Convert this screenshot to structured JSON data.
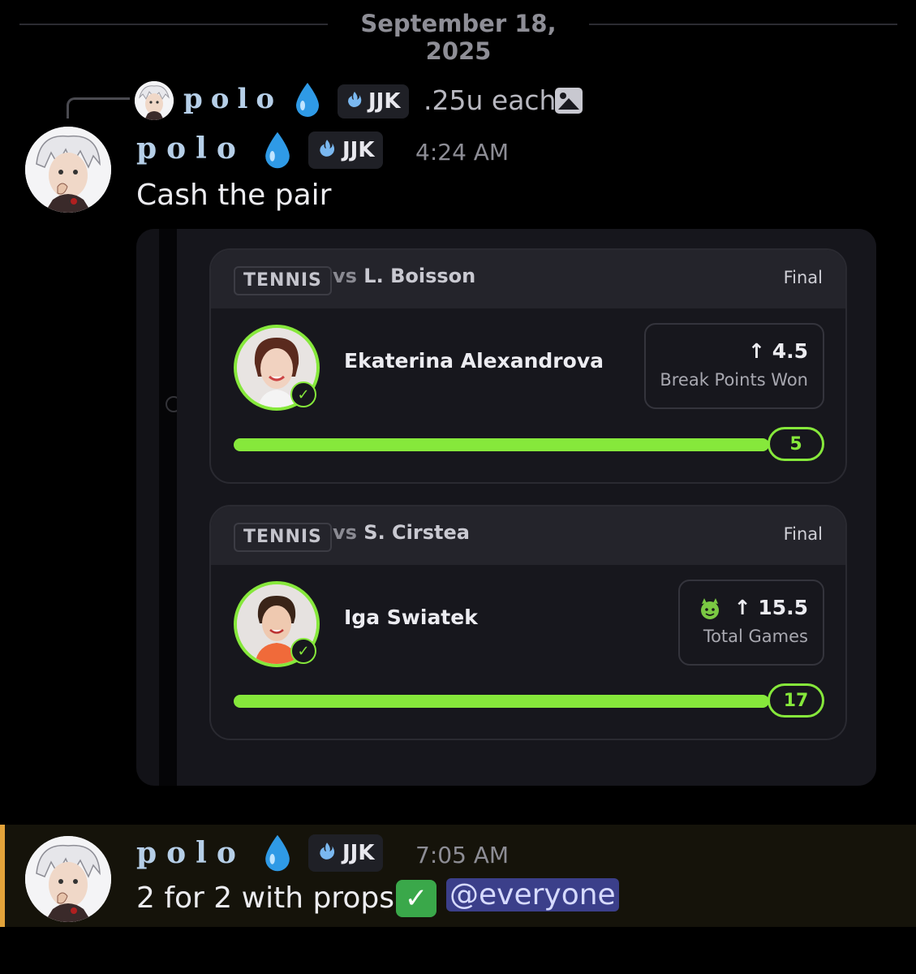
{
  "date_divider": "September 18, 2025",
  "reply": {
    "username": "polo",
    "tag": "JJK",
    "text": ".25u each"
  },
  "message1": {
    "username": "polo",
    "tag": "JJK",
    "timestamp": "4:24 AM",
    "text": "Cash the pair",
    "picks": [
      {
        "sport": "TENNIS",
        "vs_prefix": "vs",
        "opponent": "L. Boisson",
        "status": "Final",
        "player": "Ekaterina Alexandrova",
        "line": "4.5",
        "stat": "Break Points Won",
        "result": "5",
        "progress": 1.0
      },
      {
        "sport": "TENNIS",
        "vs_prefix": "vs",
        "opponent": "S. Cirstea",
        "status": "Final",
        "player": "Iga Swiatek",
        "line": "15.5",
        "stat": "Total Games",
        "result": "17",
        "progress": 1.0
      }
    ]
  },
  "message2": {
    "username": "polo",
    "tag": "JJK",
    "timestamp": "7:05 AM",
    "text": "2 for 2 with props",
    "mention": "@everyone"
  },
  "colors": {
    "accent_green": "#86e83b",
    "username_blue": "#b6cfe8",
    "mention_bg": "#3b3f8a",
    "highlight_bar": "#e3a33a"
  },
  "icons": [
    "water-drop-icon",
    "flame-icon",
    "image-icon",
    "arrow-up-icon",
    "check-badge-icon",
    "demon-emoji-icon",
    "check-mark-emoji"
  ]
}
